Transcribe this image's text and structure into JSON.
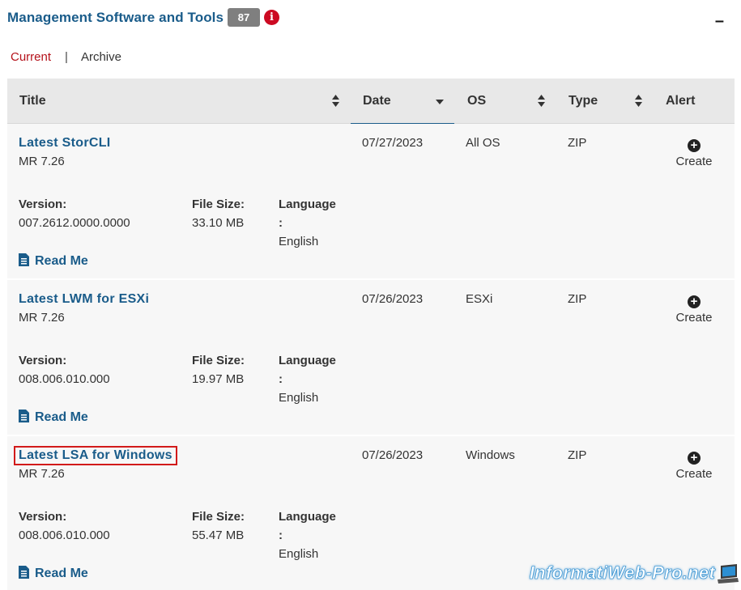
{
  "header": {
    "title": "Management Software and Tools",
    "count": "87",
    "info_icon": "i",
    "collapse_icon": "–"
  },
  "tabs": {
    "current": "Current",
    "separator": "|",
    "archive": "Archive"
  },
  "columns": {
    "title": "Title",
    "date": "Date",
    "os": "OS",
    "type": "Type",
    "alert": "Alert"
  },
  "labels": {
    "version": "Version:",
    "file_size": "File Size:",
    "language": "Language",
    "language_colon": ":",
    "read_me": "Read Me",
    "create": "Create"
  },
  "rows": [
    {
      "title": "Latest StorCLI",
      "subtitle": "MR 7.26",
      "date": "07/27/2023",
      "os": "All OS",
      "type": "ZIP",
      "version": "007.2612.0000.0000",
      "file_size": "33.10 MB",
      "language": "English"
    },
    {
      "title": "Latest LWM for ESXi",
      "subtitle": "MR 7.26",
      "date": "07/26/2023",
      "os": "ESXi",
      "type": "ZIP",
      "version": "008.006.010.000",
      "file_size": "19.97 MB",
      "language": "English"
    },
    {
      "title": "Latest LSA for Windows",
      "subtitle": "MR 7.26",
      "date": "07/26/2023",
      "os": "Windows",
      "type": "ZIP",
      "version": "008.006.010.000",
      "file_size": "55.47 MB",
      "language": "English"
    }
  ],
  "watermark": "InformatiWeb-Pro.net",
  "colors": {
    "link": "#1a5c8a",
    "accent_red": "#b5121b",
    "badge": "#7f7f7f",
    "highlight_box": "#d21a1a"
  }
}
